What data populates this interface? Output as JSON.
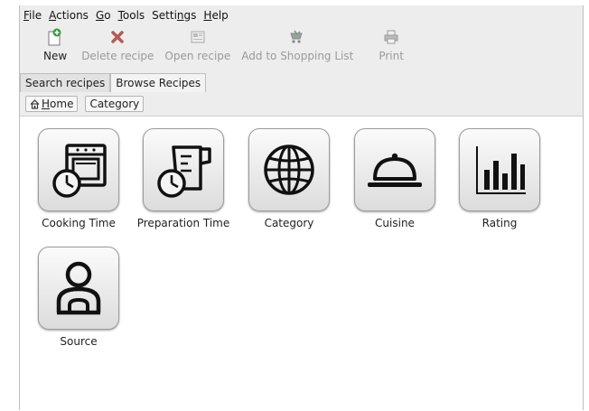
{
  "menubar": {
    "items": [
      {
        "label": "File",
        "mnemonic": "F",
        "rest": "ile"
      },
      {
        "label": "Actions",
        "mnemonic": "A",
        "rest": "ctions"
      },
      {
        "label": "Go",
        "mnemonic": "G",
        "rest": "o"
      },
      {
        "label": "Tools",
        "mnemonic": "T",
        "rest": "ools"
      },
      {
        "label": "Settings",
        "pre": "Setti",
        "mnemonic": "n",
        "rest": "gs"
      },
      {
        "label": "Help",
        "mnemonic": "H",
        "rest": "elp"
      }
    ]
  },
  "toolbar": {
    "new_label": "New",
    "delete_label": "Delete recipe",
    "open_label": "Open recipe",
    "shopping_label": "Add to Shopping List",
    "print_label": "Print"
  },
  "tabs": {
    "search": "Search recipes",
    "browse": "Browse Recipes"
  },
  "breadcrumb": {
    "home_mnemonic": "H",
    "home_rest": "ome",
    "category": "Category"
  },
  "tiles": {
    "cooking_time": "Cooking Time",
    "preparation_time": "Preparation Time",
    "category": "Category",
    "cuisine": "Cuisine",
    "rating": "Rating",
    "source": "Source"
  }
}
